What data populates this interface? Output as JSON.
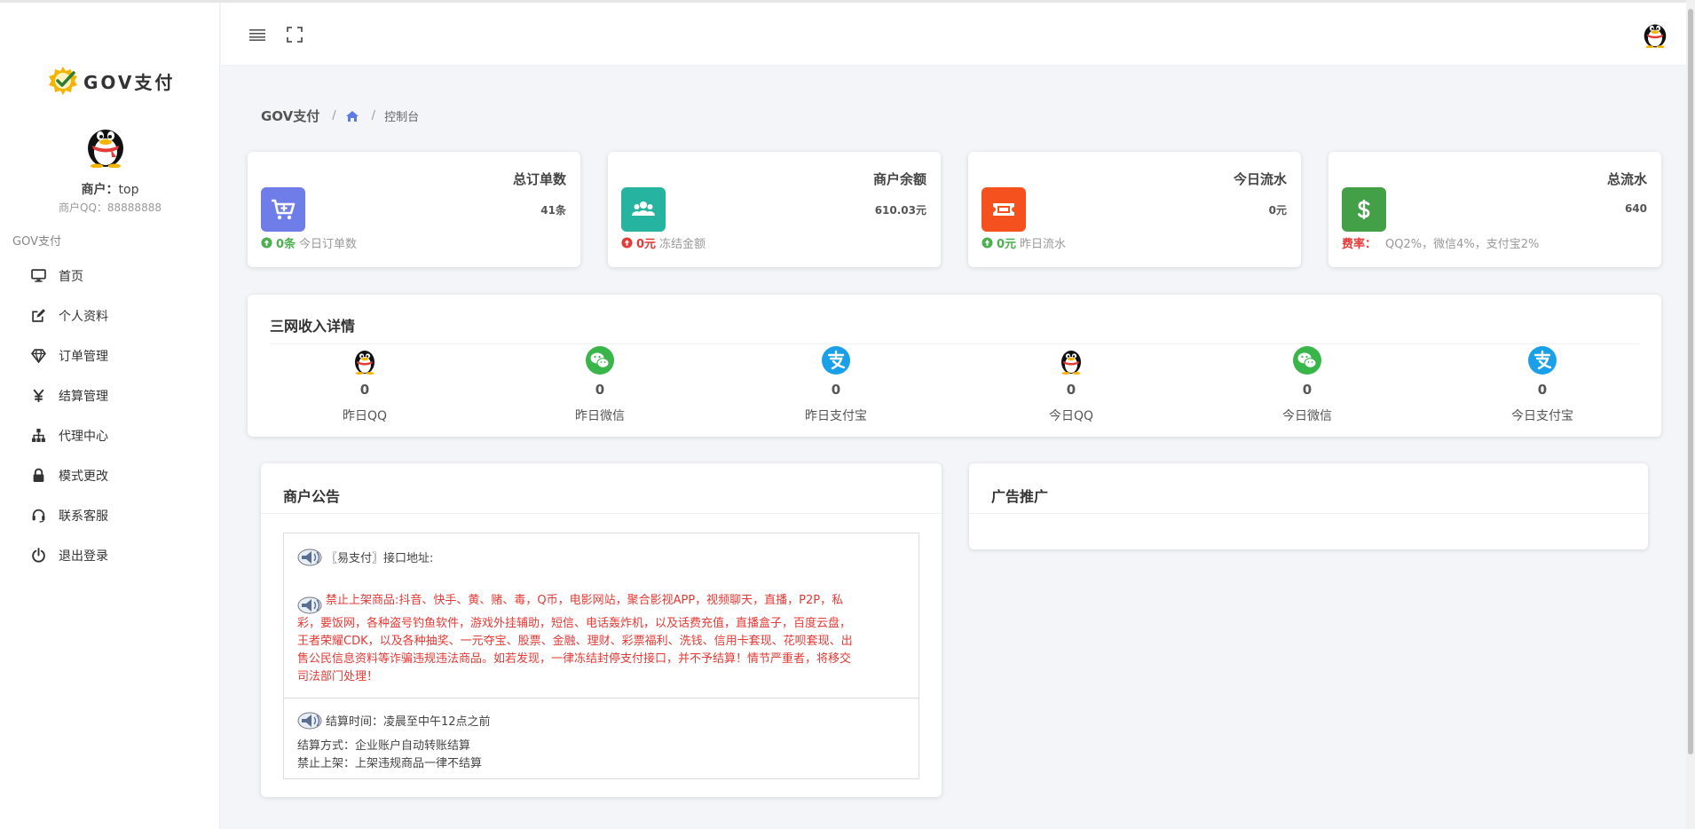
{
  "brand": {
    "name": "GOV支付"
  },
  "merchant": {
    "label": "商户：",
    "name": "top",
    "qq_text": "商户QQ：88888888"
  },
  "nav": {
    "section_title": "GOV支付",
    "items": [
      {
        "label": "首页",
        "icon": "monitor-icon"
      },
      {
        "label": "个人资料",
        "icon": "edit-icon"
      },
      {
        "label": "订单管理",
        "icon": "diamond-icon"
      },
      {
        "label": "结算管理",
        "icon": "yen-icon"
      },
      {
        "label": "代理中心",
        "icon": "sitemap-icon"
      },
      {
        "label": "模式更改",
        "icon": "lock-icon"
      },
      {
        "label": "联系客服",
        "icon": "headset-icon"
      },
      {
        "label": "退出登录",
        "icon": "power-icon"
      }
    ]
  },
  "breadcrumb": {
    "home_text": "GOV支付",
    "sep": "/",
    "current": "控制台"
  },
  "stats": [
    {
      "title": "总订单数",
      "value": "41条",
      "foot_value": "0条",
      "foot_label": "今日订单数",
      "color": "#6f7de8",
      "icon": "cart-icon",
      "foot_color": "green"
    },
    {
      "title": "商户余额",
      "value": "610.03元",
      "foot_value": "0元",
      "foot_label": "冻结金额",
      "color": "#26b3a0",
      "icon": "users-icon",
      "foot_color": "red"
    },
    {
      "title": "今日流水",
      "value": "0元",
      "foot_value": "0元",
      "foot_label": "昨日流水",
      "color": "#f4511e",
      "icon": "ticket-icon",
      "foot_color": "green"
    },
    {
      "title": "总流水",
      "value": "640",
      "fee_label": "费率：",
      "fee_text": "QQ2%，微信4%，支付宝2%",
      "color": "#43a047",
      "icon": "dollar-icon"
    }
  ],
  "income": {
    "title": "三网收入详情",
    "items": [
      {
        "label": "昨日QQ",
        "value": "0",
        "icon": "qq-icon"
      },
      {
        "label": "昨日微信",
        "value": "0",
        "icon": "wechat-icon"
      },
      {
        "label": "昨日支付宝",
        "value": "0",
        "icon": "alipay-icon"
      },
      {
        "label": "今日QQ",
        "value": "0",
        "icon": "qq-icon"
      },
      {
        "label": "今日微信",
        "value": "0",
        "icon": "wechat-icon"
      },
      {
        "label": "今日支付宝",
        "value": "0",
        "icon": "alipay-icon"
      }
    ],
    "colors": {
      "qq": "#111111",
      "wechat": "#3ab54a",
      "alipay": "#1aa0e8"
    }
  },
  "notice": {
    "title": "商户公告",
    "api_line": "〖易支付〗接口地址:",
    "warning_lines": [
      "禁止上架商品:抖音、快手、黄、赌、毒，Q币，电影网站，聚合影视APP，视频聊天，直播，P2P，私",
      "彩，要饭网，各种盗号钓鱼软件，游戏外挂辅助，短信、电话轰炸机，以及话费充值，直播盒子，百度云盘，",
      "王者荣耀CDK，以及各种抽奖、一元夺宝、股票、金融、理财、彩票福利、洗钱、信用卡套现、花呗套现、出",
      "售公民信息资料等诈骗违规违法商品。如若发现，一律冻结封停支付接口，并不予结算！情节严重者，将移交",
      "司法部门处理！"
    ],
    "settle_time": "结算时间：凌晨至中午12点之前",
    "settle_method": "结算方式：企业账户自动转账结算",
    "settle_ban": "禁止上架：上架违规商品一律不结算"
  },
  "ad": {
    "title": "广告推广"
  }
}
